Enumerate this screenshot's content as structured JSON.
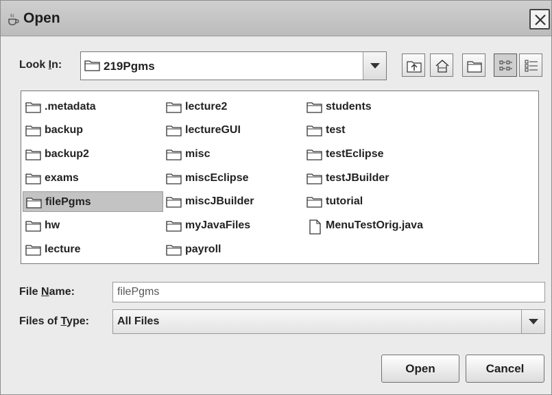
{
  "window": {
    "title": "Open",
    "app_icon": "java-cup-icon",
    "close_icon": "close-icon"
  },
  "look_in": {
    "label_prefix": "Look ",
    "label_mnemonic": "I",
    "label_suffix": "n:",
    "value": "219Pgms"
  },
  "toolbar": {
    "buttons": [
      {
        "name": "up-one-level-button",
        "icon": "up-folder-icon"
      },
      {
        "name": "home-button",
        "icon": "home-icon"
      },
      {
        "name": "new-folder-button",
        "icon": "new-folder-icon"
      },
      {
        "name": "list-view-button",
        "icon": "list-view-icon",
        "pressed": true
      },
      {
        "name": "details-view-button",
        "icon": "details-view-icon",
        "pressed": false
      }
    ]
  },
  "files": {
    "columns": [
      [
        {
          "name": ".metadata",
          "type": "folder"
        },
        {
          "name": "backup",
          "type": "folder"
        },
        {
          "name": "backup2",
          "type": "folder"
        },
        {
          "name": "exams",
          "type": "folder"
        },
        {
          "name": "filePgms",
          "type": "folder",
          "selected": true
        },
        {
          "name": "hw",
          "type": "folder"
        },
        {
          "name": "lecture",
          "type": "folder"
        }
      ],
      [
        {
          "name": "lecture2",
          "type": "folder"
        },
        {
          "name": "lectureGUI",
          "type": "folder"
        },
        {
          "name": "misc",
          "type": "folder"
        },
        {
          "name": "miscEclipse",
          "type": "folder"
        },
        {
          "name": "miscJBuilder",
          "type": "folder"
        },
        {
          "name": "myJavaFiles",
          "type": "folder"
        },
        {
          "name": "payroll",
          "type": "folder"
        }
      ],
      [
        {
          "name": "students",
          "type": "folder"
        },
        {
          "name": "test",
          "type": "folder"
        },
        {
          "name": "testEclipse",
          "type": "folder"
        },
        {
          "name": "testJBuilder",
          "type": "folder"
        },
        {
          "name": "tutorial",
          "type": "folder"
        },
        {
          "name": "MenuTestOrig.java",
          "type": "file"
        }
      ]
    ]
  },
  "file_name": {
    "label_prefix": "File ",
    "label_mnemonic": "N",
    "label_suffix": "ame:",
    "value": "filePgms"
  },
  "file_type": {
    "label_prefix": "Files of ",
    "label_mnemonic": "T",
    "label_suffix": "ype:",
    "value": "All Files"
  },
  "buttons": {
    "open": "Open",
    "cancel": "Cancel"
  }
}
